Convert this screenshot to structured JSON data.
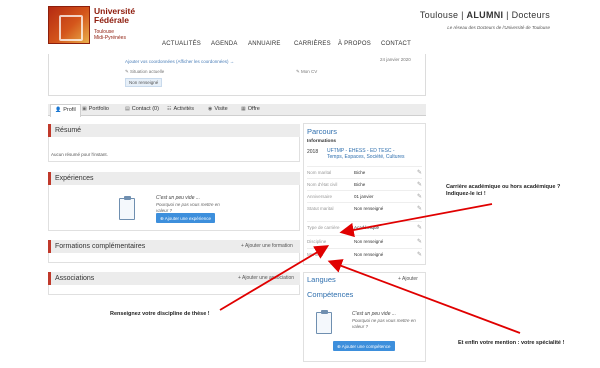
{
  "header": {
    "logo_line1": "Université",
    "logo_line2": "Fédérale",
    "logo_line3": "Toulouse",
    "logo_line4": "Midi-Pyrénées",
    "title_pre": "Toulouse | ",
    "title_bold": "ALUMNI",
    "title_post": " | Docteurs",
    "subtitle": "Le réseau des Docteurs de l'Université de Toulouse"
  },
  "nav": {
    "items": [
      "ACTUALITÉS",
      "AGENDA",
      "ANNUAIRE",
      "CARRIÈRES",
      "À PROPOS",
      "CONTACT"
    ]
  },
  "top_card": {
    "add_coords": "Ajouter vos coordonnées  (Afficher les coordonnées)  →",
    "date": "24 janvier 2020",
    "current_situation": "Situation actuelle",
    "my_cv": "Mon CV",
    "badge": "Non renseigné"
  },
  "tabs": [
    {
      "label": "Profil",
      "icon": "user-icon"
    },
    {
      "label": "Portfolio",
      "icon": "portfolio-icon"
    },
    {
      "label": "Contact (0)",
      "icon": "contact-icon"
    },
    {
      "label": "Activités",
      "icon": "activity-icon"
    },
    {
      "label": "Visite",
      "icon": "eye-icon"
    },
    {
      "label": "Offre",
      "icon": "offer-icon"
    }
  ],
  "left": {
    "resume_title": "Résumé",
    "resume_text": "Aucun résumé pour l'instant.",
    "experiences_title": "Expériences",
    "empty_line1": "C'est un peu vide ...",
    "empty_line2": "Pourquoi ne pas vous mettre en valeur ?",
    "add_experience": "Ajouter une expérience",
    "formations_title": "Formations complémentaires",
    "add_formation": "+ Ajouter une formation",
    "associations_title": "Associations",
    "add_association": "+ Ajouter une association"
  },
  "right": {
    "parcours_title": "Parcours",
    "informations": "Informations",
    "year": "2018",
    "program": "UFTMP - EHESS - ED TESC - Temps, Espaces, Société, Cultures",
    "fields": [
      {
        "key": "Nom marital",
        "value": "Biche"
      },
      {
        "key": "Nom d'état civil",
        "value": "Biche"
      },
      {
        "key": "Anniversaire",
        "value": "01 janvier"
      },
      {
        "key": "Statut marital",
        "value": "Non renseigné"
      },
      {
        "key": "Type de carrière",
        "value": "Académique"
      },
      {
        "key": "Discipline",
        "value": "Non renseigné"
      },
      {
        "key": "Mention",
        "value": "Non renseigné"
      }
    ],
    "langues_title": "Langues",
    "add_langue": "+ Ajouter",
    "competences_title": "Compétences",
    "empty_line1": "C'est un peu vide ...",
    "empty_line2": "Pourquoi ne pas vous mettre en valeur ?",
    "add_competence": "Ajouter une compétence"
  },
  "annotations": {
    "career_line1": "Carrière académique ou hors académique ?",
    "career_line2": "Indiquez-le ici !",
    "discipline": "Renseignez votre discipline de thèse !",
    "mention": "Et enfin votre mention : votre spécialité !"
  },
  "colors": {
    "accent_red": "#c0392b",
    "link_blue": "#2f6fae",
    "button_blue": "#3d8fdc",
    "arrow_red": "#e00000"
  }
}
